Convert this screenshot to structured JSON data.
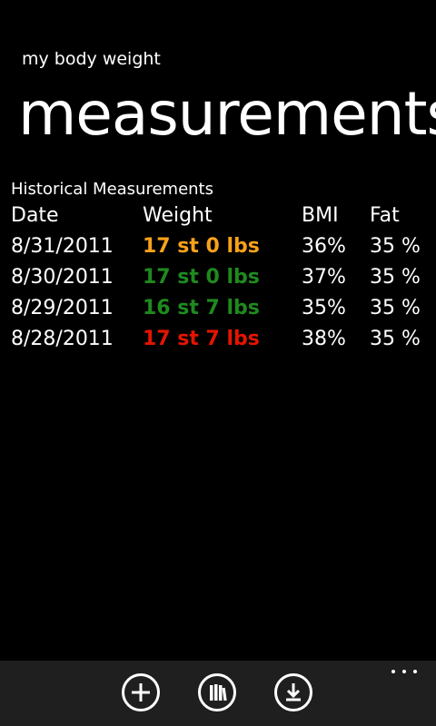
{
  "app_title": "my body weight",
  "page_title": "measurements",
  "section_title": "Historical Measurements",
  "table": {
    "headers": {
      "date": "Date",
      "weight": "Weight",
      "bmi": "BMI",
      "fat": "Fat"
    },
    "rows": [
      {
        "date": "8/31/2011",
        "weight": "17 st 0 lbs",
        "bmi": "36%",
        "fat": "35 %",
        "weight_color": "#f7a21b"
      },
      {
        "date": "8/30/2011",
        "weight": "17 st 0 lbs",
        "bmi": "37%",
        "fat": "35 %",
        "weight_color": "#1f8a1f"
      },
      {
        "date": "8/29/2011",
        "weight": "16 st 7 lbs",
        "bmi": "35%",
        "fat": "35 %",
        "weight_color": "#1f8a1f"
      },
      {
        "date": "8/28/2011",
        "weight": "17 st 7 lbs",
        "bmi": "38%",
        "fat": "35 %",
        "weight_color": "#e51400"
      }
    ]
  },
  "app_bar": {
    "background": "#1f1f1f",
    "buttons": [
      {
        "icon": "add-icon"
      },
      {
        "icon": "library-icon"
      },
      {
        "icon": "download-icon"
      }
    ],
    "more_icon": "ellipsis-icon"
  }
}
